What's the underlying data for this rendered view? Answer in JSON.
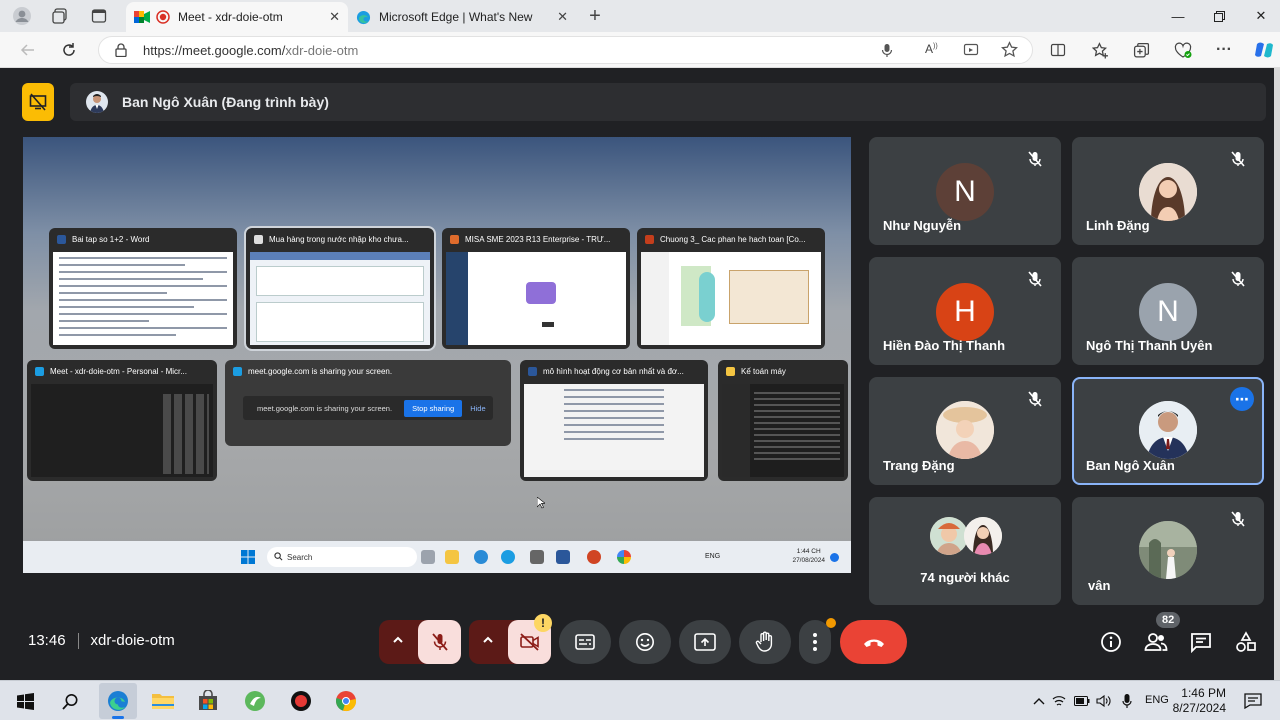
{
  "browser": {
    "tabs": [
      {
        "label": "Meet - xdr-doie-otm",
        "active": true
      },
      {
        "label": "Microsoft Edge | What's New",
        "active": false
      }
    ],
    "url_host": "https://meet.google.com/",
    "url_path": "xdr-doie-otm"
  },
  "meet": {
    "presenter_label": "Ban Ngô Xuân (Đang trình bày)",
    "shared_screen": {
      "windows": [
        {
          "title": "Bai tap so 1+2 - Word"
        },
        {
          "title": "Mua hàng trong nước nhập kho chưa..."
        },
        {
          "title": "MISA SME 2023 R13 Enterprise - TRƯ..."
        },
        {
          "title": "Chuong 3_ Cac phan he hach toan [Co..."
        },
        {
          "title": "Meet - xdr-doie-otm - Personal - Micr..."
        },
        {
          "title": "meet.google.com is sharing your screen."
        },
        {
          "title": "mô hình hoạt động cơ bản nhất và đơ..."
        },
        {
          "title": "Kế toán máy"
        }
      ],
      "sharing_bar_text": "meet.google.com is sharing your screen.",
      "stop_sharing_label": "Stop sharing",
      "hide_label": "Hide",
      "taskbar_search": "Search",
      "taskbar_lang": "ENG",
      "taskbar_time": "1:44 CH",
      "taskbar_date": "27/08/2024"
    },
    "participants": [
      {
        "name": "Như Nguyễn",
        "initial": "N",
        "color": "#5d4037",
        "muted": true
      },
      {
        "name": "Linh Đặng",
        "initial": "",
        "color": "#c89f8a",
        "muted": true
      },
      {
        "name": "Hiền Đào Thị Thanh",
        "initial": "H",
        "color": "#d84315",
        "muted": true
      },
      {
        "name": "Ngô Thị Thanh Uyên",
        "initial": "N",
        "color": "#9aa3ad",
        "muted": true
      },
      {
        "name": "Trang Đặng",
        "initial": "",
        "color": "#e7d2c4",
        "muted": true
      },
      {
        "name": "Ban Ngô Xuân",
        "initial": "",
        "color": "#e6edf3",
        "muted": false,
        "speaking": true
      },
      {
        "name": "74 người khác",
        "initial": "",
        "color": "#3c4043",
        "muted": false
      },
      {
        "name": "vân",
        "initial": "",
        "color": "#8d9a8a",
        "muted": true
      }
    ],
    "time": "13:46",
    "room_code": "xdr-doie-otm",
    "participant_count": "82"
  },
  "os": {
    "lang": "ENG",
    "time": "1:46 PM",
    "date": "8/27/2024"
  }
}
